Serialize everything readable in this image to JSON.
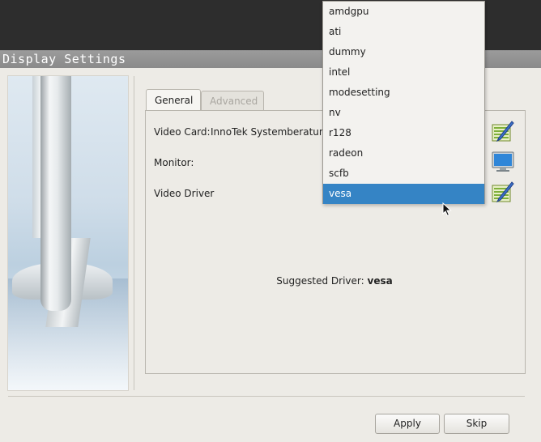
{
  "window": {
    "title": "Display Settings"
  },
  "tabs": [
    {
      "label": "General",
      "active": true
    },
    {
      "label": "Advanced",
      "active": false
    }
  ],
  "general": {
    "video_card_label": "Video Card:",
    "video_card_value": "InnoTek Systemberatung",
    "monitor_label": "Monitor:",
    "video_driver_label": "Video Driver",
    "suggested_label": "Suggested Driver:",
    "suggested_value": "vesa"
  },
  "driver_dropdown": {
    "options": [
      "amdgpu",
      "ati",
      "dummy",
      "intel",
      "modesetting",
      "nv",
      "r128",
      "radeon",
      "scfb",
      "vesa"
    ],
    "selected": "vesa"
  },
  "buttons": {
    "apply": "Apply",
    "skip": "Skip"
  },
  "colors": {
    "selection": "#3584c5",
    "titlebar": "#8f8f8f"
  }
}
